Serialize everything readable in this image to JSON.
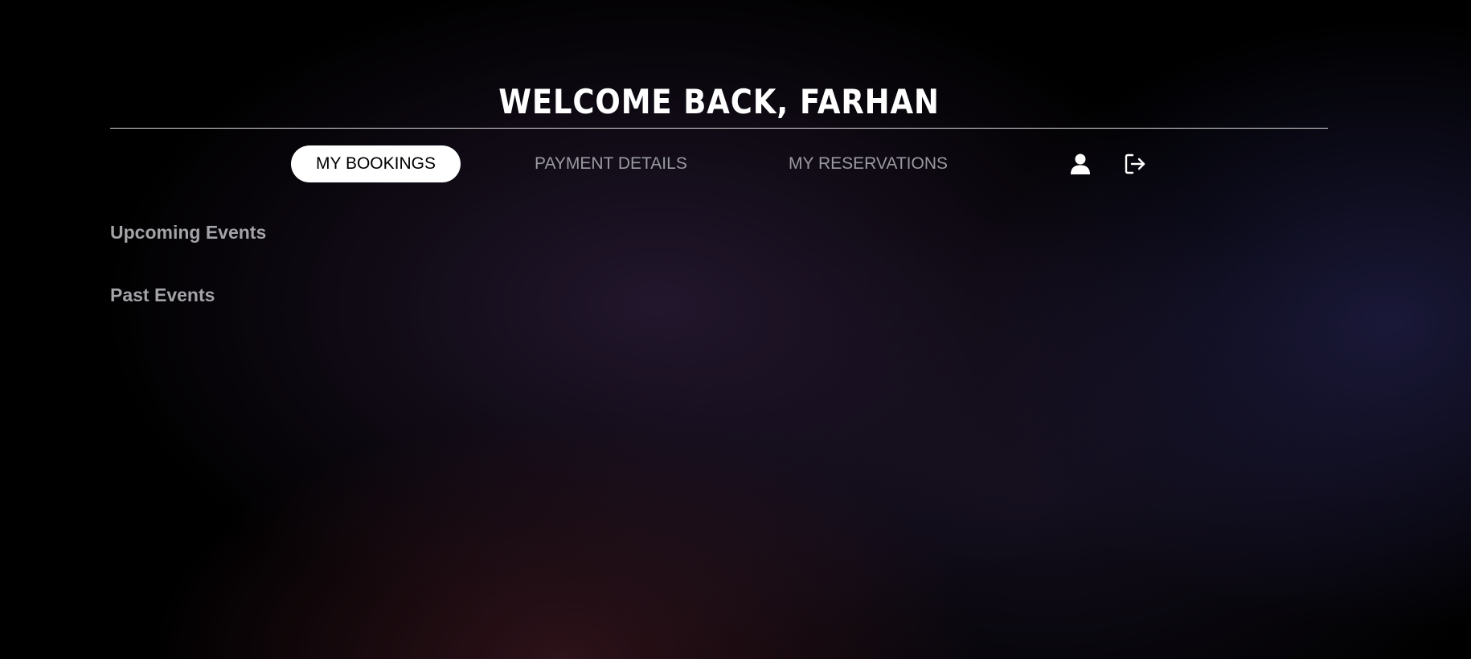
{
  "header": {
    "title": "WELCOME BACK, FARHAN"
  },
  "nav": {
    "tabs": [
      {
        "label": "MY BOOKINGS",
        "active": true
      },
      {
        "label": "PAYMENT DETAILS",
        "active": false
      },
      {
        "label": "MY RESERVATIONS",
        "active": false
      }
    ],
    "icons": {
      "profile": "user-icon",
      "logout": "logout-icon"
    }
  },
  "bookings": {
    "sections": [
      {
        "label": "Upcoming Events"
      },
      {
        "label": "Past Events"
      }
    ]
  },
  "colors": {
    "background": "#000000",
    "active_tab_bg": "#ffffff",
    "active_tab_text": "#000000",
    "inactive_text": "#9a9aa0",
    "title": "#ffffff"
  }
}
